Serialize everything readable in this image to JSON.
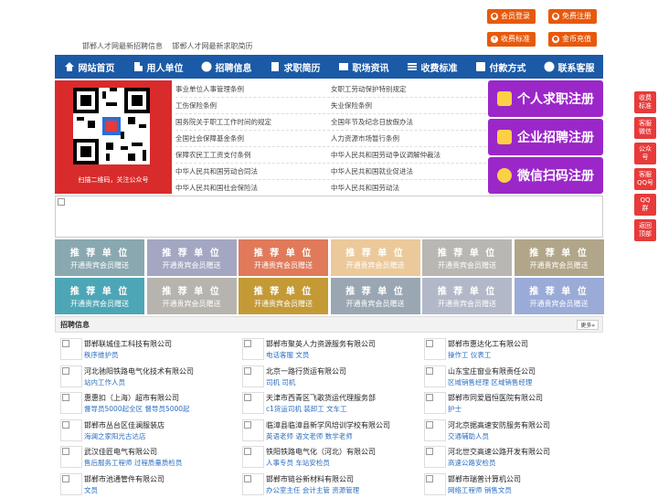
{
  "top_buttons": {
    "member_login": "会员登录",
    "free_register": "免费注册",
    "fee_standard": "收费标准",
    "recharge": "金币充值"
  },
  "head_links": [
    "邯郸人才网最新招聘信息",
    "邯郸人才网最新求职简历"
  ],
  "nav": [
    {
      "label": "网站首页",
      "icon": "home-icon"
    },
    {
      "label": "用人单位",
      "icon": "building-icon"
    },
    {
      "label": "招聘信息",
      "icon": "megaphone-icon"
    },
    {
      "label": "求职简历",
      "icon": "resume-icon"
    },
    {
      "label": "职场资讯",
      "icon": "news-icon"
    },
    {
      "label": "收费标准",
      "icon": "list-icon"
    },
    {
      "label": "付款方式",
      "icon": "payment-icon"
    },
    {
      "label": "联系客服",
      "icon": "phone-icon"
    }
  ],
  "qr": {
    "caption": "扫描二维码，关注公众号"
  },
  "links": [
    [
      "事业单位人事管理条例",
      "女职工劳动保护特别规定"
    ],
    [
      "工伤保险条例",
      "失业保险条例"
    ],
    [
      "国务院关于职工工作时间的规定",
      "全国年节及纪念日放假办法"
    ],
    [
      "全国社会保障基金条例",
      "人力资源市场暂行条例"
    ],
    [
      "保障农民工工资支付条例",
      "中华人民共和国劳动争议调解仲裁法"
    ],
    [
      "中华人民共和国劳动合同法",
      "中华人民共和国就业促进法"
    ],
    [
      "中华人民共和国社会保险法",
      "中华人民共和国劳动法"
    ]
  ],
  "register": {
    "job_seeker": "个人求职注册",
    "enterprise": "企业招聘注册",
    "wechat": "微信扫码注册"
  },
  "recommend": {
    "title": "推 荐 单 位",
    "subtitle": "开通贵宾会员赠送",
    "colors": [
      "#8aa8b0",
      "#a3a7c2",
      "#e07a5a",
      "#ecc99a",
      "#b9b7b3",
      "#b1a689",
      "#4ca6b6",
      "#b7b3ae",
      "#c49a36",
      "#9aa7b3",
      "#b3b8c9",
      "#9aabd8"
    ]
  },
  "sidebar": [
    {
      "label": "收费\n标准"
    },
    {
      "label": "客服\n微信"
    },
    {
      "label": "公众\n号"
    },
    {
      "label": "客服\nQQ号"
    },
    {
      "label": "QQ\n群"
    },
    {
      "label": "返回\n顶部"
    }
  ],
  "jobs": {
    "title": "招聘信息",
    "more": "更多»",
    "columns": [
      [
        {
          "company": "邯郸联城佳工科技有限公司",
          "positions": "秩序维护员"
        },
        {
          "company": "河北驰阳铁路电气化技术有限公司",
          "positions": "站内工作人员"
        },
        {
          "company": "惠惠扣（上海）超市有限公司",
          "positions": "督导员5000起全区 督导员5000起"
        },
        {
          "company": "邯郸市丛台区佳澜服装店",
          "positions": "海澜之家阳光古达店"
        },
        {
          "company": "武汉佳匠电气有限公司",
          "positions": "售后服务工程师 过程质量质检员"
        },
        {
          "company": "邯郸市池通管件有限公司",
          "positions": "文员"
        }
      ],
      [
        {
          "company": "邯郸市聚英人力资源服务有限公司",
          "positions": "电话客服 文员"
        },
        {
          "company": "北京一路行货运有限公司",
          "positions": "司机 司机"
        },
        {
          "company": "天津市西青区飞歌货运代理服务部",
          "positions": "c1货运司机 装卸工 文车工"
        },
        {
          "company": "临漳县临漳县新学风培训学校有限公司",
          "positions": "英语老师 语文老师 数学老师"
        },
        {
          "company": "铁阳铁路电气化（河北）有限公司",
          "positions": "人事专员 车站安检员"
        },
        {
          "company": "邯郸市链谷新材料有限公司",
          "positions": "办公室主任 会计主管 资源管理"
        }
      ],
      [
        {
          "company": "邯郸市惠达化工有限公司",
          "positions": "操作工 仪表工"
        },
        {
          "company": "山东宝庄窗业有限责任公司",
          "positions": "区域销售经理 区域销售经理"
        },
        {
          "company": "邯郸市同爱眉恒医院有限公司",
          "positions": "护士"
        },
        {
          "company": "河北京据高速安防服务有限公司",
          "positions": "交通辅助人员"
        },
        {
          "company": "河北世交高速公路开发有限公司",
          "positions": "高速公路安检员"
        },
        {
          "company": "邯郸市瑞普计算机公司",
          "positions": "网络工程师 销售文员"
        }
      ]
    ]
  }
}
